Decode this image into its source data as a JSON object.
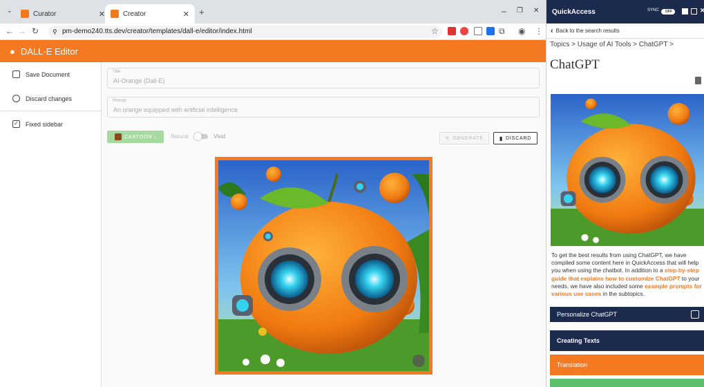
{
  "browser": {
    "tabs": [
      {
        "label": "Curator",
        "active": false
      },
      {
        "label": "Creator",
        "active": true
      }
    ],
    "url": "pm-demo240.tts.dev/creator/templates/dall-e/editor/index.html"
  },
  "app": {
    "title": "DALL-E Editor",
    "accent": "#f47920"
  },
  "sidebar": {
    "items": [
      {
        "label": "Save Document",
        "icon": "save-icon"
      },
      {
        "label": "Discard changes",
        "icon": "cancel-icon"
      },
      {
        "label": "Fixed sidebar",
        "icon": "checkbox-icon"
      }
    ]
  },
  "form": {
    "title_label": "Title",
    "title_value": "AI-Orange (Dall-E)",
    "prompt_label": "Prompt",
    "prompt_value": "An orange equipped with artificial intelligence",
    "style_button": "CARTOON ›",
    "toggle_left": "Natural",
    "toggle_right": "Vivid",
    "generate": "GENERATE",
    "discard": "DISCARD"
  },
  "quickaccess": {
    "title": "QuickAccess",
    "sync": "SYNC",
    "sync_state": "OFF",
    "back": "Back to the search results",
    "breadcrumb": "Topics > Usage of AI Tools > ChatGPT >",
    "heading": "ChatGPT",
    "text_1": "To get the best results from using ChatGPT, we have compiled some content here in QuickAccess that will help you when using the chatbot. In addition to a ",
    "link_1": "step-by-step guide that explains how to customize ChatGPT",
    "text_2": " to your needs, we have also included some ",
    "link_2": "example prompts for various use cases",
    "text_3": " in the subtopics.",
    "topics": [
      {
        "label": "Personalize ChatGPT",
        "color": "#1c2a4d"
      },
      {
        "label": "Creating Texts",
        "color": "#1c2a4d"
      },
      {
        "label": "Translation",
        "color": "#f47920"
      }
    ]
  }
}
